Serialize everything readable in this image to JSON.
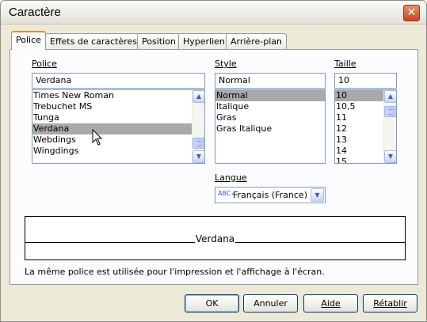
{
  "window": {
    "title": "Caractère"
  },
  "tabs": [
    {
      "label": "Police",
      "active": true
    },
    {
      "label": "Effets de caractères",
      "active": false
    },
    {
      "label": "Position",
      "active": false
    },
    {
      "label": "Hyperlien",
      "active": false
    },
    {
      "label": "Arrière-plan",
      "active": false
    }
  ],
  "font": {
    "label": "Police",
    "value": "Verdana",
    "items": [
      "Times New Roman",
      "Trebuchet MS",
      "Tunga",
      "Verdana",
      "Webdings",
      "Wingdings"
    ],
    "selected": "Verdana"
  },
  "style": {
    "label": "Style",
    "value": "Normal",
    "items": [
      "Normal",
      "Italique",
      "Gras",
      "Gras Italique"
    ],
    "selected": "Normal"
  },
  "size": {
    "label": "Taille",
    "value": "10",
    "items": [
      "10",
      "10,5",
      "11",
      "12",
      "13",
      "14",
      "15"
    ],
    "selected": "10"
  },
  "language": {
    "label": "Langue",
    "value": "Français (France)",
    "icon": "spellcheck-icon"
  },
  "preview": {
    "text": "Verdana"
  },
  "info": "La même police est utilisée pour l'impression et l'affichage à l'écran.",
  "buttons": {
    "ok": "OK",
    "cancel": "Annuler",
    "help": "Aide",
    "reset": "Rétablir"
  },
  "colors": {
    "tab_accent": "#e68b2c",
    "selection": "#a9a9a9",
    "close": "#c74523"
  }
}
